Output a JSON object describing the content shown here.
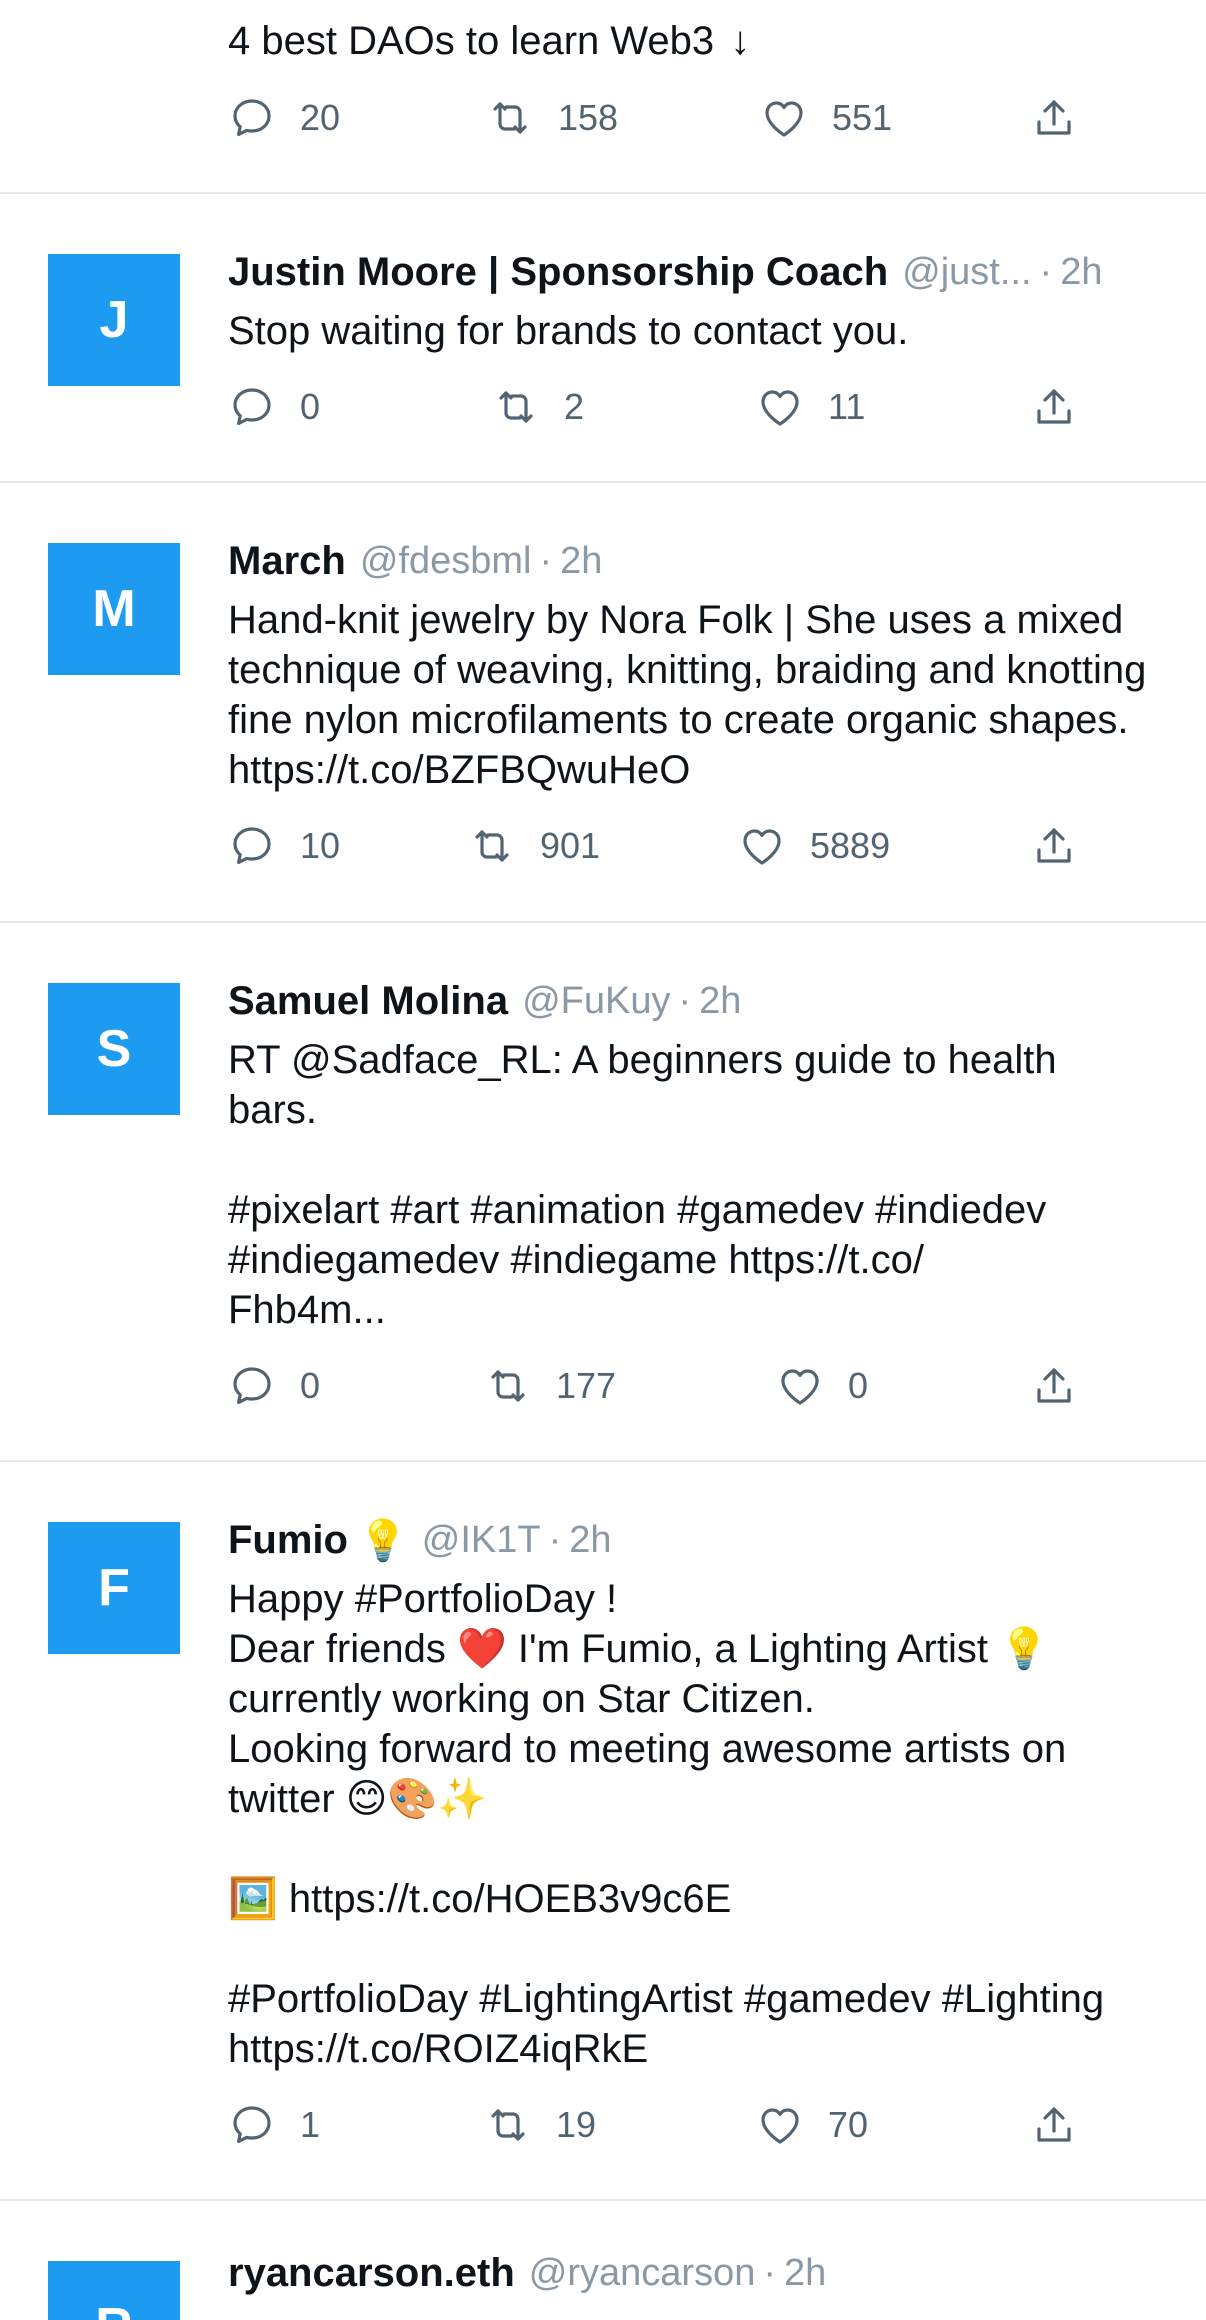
{
  "tweets": [
    {
      "text": "4 best DAOs to learn Web3",
      "arrow": "↓",
      "replies": "20",
      "retweets": "158",
      "likes": "551"
    },
    {
      "avatar": "J",
      "name": "Justin Moore | Sponsorship Coach",
      "handle": "@just...",
      "time": "2h",
      "text": "Stop waiting for brands to contact you.",
      "replies": "0",
      "retweets": "2",
      "likes": "11"
    },
    {
      "avatar": "M",
      "name": "March",
      "handle": "@fdesbml",
      "time": "2h",
      "text": "Hand-knit jewelry by Nora Folk | She uses a mixed technique of weaving, knitting, braiding and knotting fine nylon microfilaments to create organic shapes. https://t.co/BZFBQwuHeO",
      "replies": "10",
      "retweets": "901",
      "likes": "5889"
    },
    {
      "avatar": "S",
      "name": "Samuel Molina",
      "handle": "@FuKuy",
      "time": "2h",
      "text": "RT @Sadface_RL: A beginners guide to health bars.\n\n#pixelart #art #animation #gamedev #indiedev #indiegamedev #indiegame https://t.co/\nFhb4m...",
      "replies": "0",
      "retweets": "177",
      "likes": "0"
    },
    {
      "avatar": "F",
      "name": "Fumio",
      "name_emoji": "💡",
      "handle": "@IK1T",
      "time": "2h",
      "text": "Happy #PortfolioDay !\nDear friends ❤️ I'm Fumio, a Lighting Artist 💡 currently working on Star Citizen.\nLooking forward to meeting awesome artists on twitter 😊🎨✨\n\n🖼️ https://t.co/HOEB3v9c6E\n\n#PortfolioDay #LightingArtist #gamedev #Lighting https://t.co/ROIZ4iqRkE",
      "replies": "1",
      "retweets": "19",
      "likes": "70"
    },
    {
      "avatar": "R",
      "name": "ryancarson.eth",
      "handle": "@ryancarson",
      "time": "2h"
    }
  ],
  "colors": {
    "accent": "#1d9bf0",
    "text": "#0f1419",
    "secondary": "#8b98a5",
    "divider": "#e7e9ea"
  },
  "icons": {
    "reply": "reply-icon",
    "retweet": "retweet-icon",
    "like": "heart-icon",
    "share": "share-icon"
  }
}
